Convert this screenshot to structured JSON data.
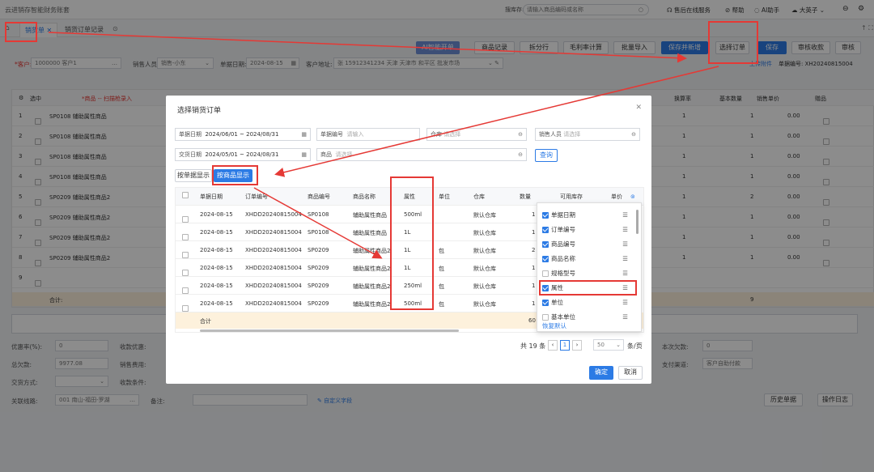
{
  "app": {
    "title": "云进销存智能财务账套"
  },
  "topbar": {
    "search_label": "搜库存:",
    "search_placeholder": "请输入商品编码或名称",
    "service": "售后在线服务",
    "help": "帮助",
    "ai": "AI助手",
    "user": "大英子"
  },
  "tabs": [
    {
      "label": "销货单"
    },
    {
      "label": "销货订单记录"
    }
  ],
  "toolbar": {
    "smart": "AI智能开单",
    "b1": "商品记录",
    "b2": "拆分行",
    "b3": "毛利率计算",
    "b4": "批量导入",
    "save_new": "保存并新增",
    "select_order": "选择订单",
    "save": "保存",
    "audit_collect": "审核收款",
    "audit": "审核"
  },
  "form": {
    "customer_label": "*客户:",
    "customer_value": "1000000 客户1",
    "salesperson_label": "销售人员:",
    "salesperson_value": "销售-小东",
    "date_label": "单据日期:",
    "date_value": "2024-08-15",
    "address_label": "客户地址:",
    "address_value": "张 15912341234 天津 天津市 和平区 批发市场",
    "attach": "上传附件",
    "docno_label": "单据编号:",
    "docno_value": "XH20240815004"
  },
  "grid": {
    "headers": {
      "sel": "选中",
      "product": "*商品 -- 扫描枪录入",
      "conv": "换算率",
      "base_qty": "基本数量",
      "price": "销售单价",
      "gift": "赠品"
    },
    "rows": [
      {
        "no": "1",
        "product": "SP0108 辅助属性商品",
        "conv": "1",
        "base_qty": "1",
        "price": "0.00"
      },
      {
        "no": "2",
        "product": "SP0108 辅助属性商品",
        "conv": "1",
        "base_qty": "1",
        "price": "0.00"
      },
      {
        "no": "3",
        "product": "SP0108 辅助属性商品",
        "conv": "1",
        "base_qty": "1",
        "price": "0.00"
      },
      {
        "no": "4",
        "product": "SP0108 辅助属性商品",
        "conv": "1",
        "base_qty": "1",
        "price": "0.00"
      },
      {
        "no": "5",
        "product": "SP0209 辅助属性商品2",
        "conv": "1",
        "base_qty": "2",
        "price": "0.00"
      },
      {
        "no": "6",
        "product": "SP0209 辅助属性商品2",
        "conv": "1",
        "base_qty": "1",
        "price": "0.00"
      },
      {
        "no": "7",
        "product": "SP0209 辅助属性商品2",
        "conv": "1",
        "base_qty": "1",
        "price": "0.00"
      },
      {
        "no": "8",
        "product": "SP0209 辅助属性商品2",
        "conv": "1",
        "base_qty": "1",
        "price": "0.00"
      },
      {
        "no": "9",
        "product": "",
        "conv": "",
        "base_qty": "",
        "price": ""
      }
    ],
    "total_label": "合计:",
    "total_qty": "9"
  },
  "bottom": {
    "discount_rate_label": "优惠率(%):",
    "discount_rate": "0",
    "discount_amt_label": "收款优惠:",
    "total_label": "总欠款:",
    "total": "9977.08",
    "sales_cost_label": "销售费用:",
    "trade_label": "交货方式:",
    "collect_cond_label": "收款条件:",
    "logistics_label": "关联线路:",
    "logistics_value": "001 南山-福田-罗湖",
    "remark_label": "备注:",
    "custom_fields": "自定义字段",
    "current_pay_label": "本次欠款:",
    "current_pay": "0",
    "pay_channel_label": "支付渠道:",
    "pay_channel": "客户自助付款",
    "history": "历史单据",
    "log": "操作日志"
  },
  "modal": {
    "title": "选择销货订单",
    "filters": {
      "doc_date_label": "单据日期",
      "doc_date_value": "2024/06/01 ~ 2024/08/31",
      "doc_no_label": "单据编号",
      "doc_no_placeholder": "请输入",
      "warehouse_label": "仓库",
      "warehouse_placeholder": "请选择",
      "salesperson_label": "销售人员",
      "salesperson_placeholder": "请选择",
      "delivery_date_label": "交货日期",
      "delivery_date_value": "2024/05/01 ~ 2024/08/31",
      "product_label": "商品",
      "product_placeholder": "请选择",
      "query": "查询"
    },
    "view_by_doc": "按单据显示",
    "view_by_product": "按商品显示",
    "columns": [
      "单据日期",
      "订单编号",
      "商品编号",
      "商品名称",
      "属性",
      "单位",
      "仓库",
      "数量",
      "可用库存",
      "单价"
    ],
    "rows": [
      {
        "date": "2024-08-15",
        "order": "XHDD20240815004",
        "code": "SP0108",
        "name": "辅助属性商品",
        "attr": "500ml",
        "unit": "",
        "wh": "默认仓库",
        "qty": "1"
      },
      {
        "date": "2024-08-15",
        "order": "XHDD20240815004",
        "code": "SP0108",
        "name": "辅助属性商品",
        "attr": "1L",
        "unit": "",
        "wh": "默认仓库",
        "qty": "1"
      },
      {
        "date": "2024-08-15",
        "order": "XHDD20240815004",
        "code": "SP0209",
        "name": "辅助属性商品2",
        "attr": "1L",
        "unit": "包",
        "wh": "默认仓库",
        "qty": "2"
      },
      {
        "date": "2024-08-15",
        "order": "XHDD20240815004",
        "code": "SP0209",
        "name": "辅助属性商品2",
        "attr": "1L",
        "unit": "包",
        "wh": "默认仓库",
        "qty": "1"
      },
      {
        "date": "2024-08-15",
        "order": "XHDD20240815004",
        "code": "SP0209",
        "name": "辅助属性商品2",
        "attr": "250ml",
        "unit": "包",
        "wh": "默认仓库",
        "qty": "1"
      },
      {
        "date": "2024-08-15",
        "order": "XHDD20240815004",
        "code": "SP0209",
        "name": "辅助属性商品2",
        "attr": "500ml",
        "unit": "包",
        "wh": "默认仓库",
        "qty": "1"
      }
    ],
    "total_label": "合计",
    "total_qty": "60",
    "pagination": {
      "total": "共 19 条",
      "page": "1",
      "size": "50",
      "unit": "条/页"
    },
    "column_panel": {
      "items": [
        {
          "label": "单据日期",
          "checked": true
        },
        {
          "label": "订单编号",
          "checked": true
        },
        {
          "label": "商品编号",
          "checked": true
        },
        {
          "label": "商品名称",
          "checked": true
        },
        {
          "label": "规格型号",
          "checked": false
        },
        {
          "label": "属性",
          "checked": true
        },
        {
          "label": "单位",
          "checked": true
        },
        {
          "label": "基本单位",
          "checked": false
        }
      ],
      "restore": "恢复默认"
    },
    "ok": "确定",
    "cancel": "取消"
  }
}
